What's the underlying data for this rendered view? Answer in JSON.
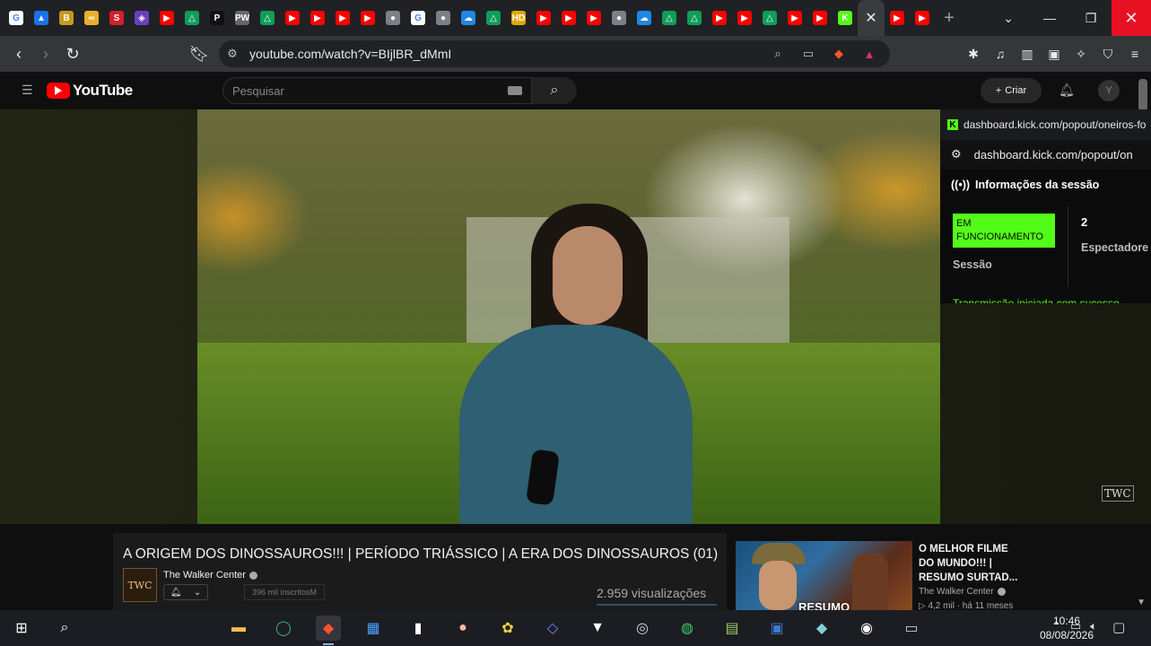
{
  "browser": {
    "tabs": [
      {
        "icon": "google-icon",
        "color": "#ffffff",
        "glyph": "G"
      },
      {
        "icon": "drive-icon",
        "color": "#1a73e8",
        "glyph": "▲"
      },
      {
        "icon": "b-icon",
        "color": "#c49a1c",
        "glyph": "B"
      },
      {
        "icon": "link-icon",
        "color": "#e8b02c",
        "glyph": "∞"
      },
      {
        "icon": "red-s-icon",
        "color": "#d4202a",
        "glyph": "S"
      },
      {
        "icon": "purple-app-icon",
        "color": "#6a3fbf",
        "glyph": "◈"
      },
      {
        "icon": "youtube-icon",
        "color": "#ff0000",
        "glyph": "▶"
      },
      {
        "icon": "google-drive-icon",
        "color": "#0f9d58",
        "glyph": "△"
      },
      {
        "icon": "p-icon",
        "color": "#111111",
        "glyph": "P"
      },
      {
        "icon": "pwm-icon",
        "color": "#666666",
        "glyph": "PW"
      },
      {
        "icon": "google-drive-icon",
        "color": "#0f9d58",
        "glyph": "△"
      },
      {
        "icon": "youtube-icon",
        "color": "#ff0000",
        "glyph": "▶"
      },
      {
        "icon": "youtube-icon",
        "color": "#ff0000",
        "glyph": "▶"
      },
      {
        "icon": "youtube-icon",
        "color": "#ff0000",
        "glyph": "▶"
      },
      {
        "icon": "youtube-icon",
        "color": "#ff0000",
        "glyph": "▶"
      },
      {
        "icon": "github-icon",
        "color": "#7a7f88",
        "glyph": "●"
      },
      {
        "icon": "google-icon",
        "color": "#ffffff",
        "glyph": "G"
      },
      {
        "icon": "github-icon",
        "color": "#7a7f88",
        "glyph": "●"
      },
      {
        "icon": "cloud-icon",
        "color": "#1e88e5",
        "glyph": "☁"
      },
      {
        "icon": "google-drive-icon",
        "color": "#0f9d58",
        "glyph": "△"
      },
      {
        "icon": "hd-icon",
        "color": "#e0a800",
        "glyph": "HD"
      },
      {
        "icon": "youtube-icon",
        "color": "#ff0000",
        "glyph": "▶"
      },
      {
        "icon": "youtube-icon",
        "color": "#ff0000",
        "glyph": "▶"
      },
      {
        "icon": "youtube-icon",
        "color": "#ff0000",
        "glyph": "▶"
      },
      {
        "icon": "github-icon",
        "color": "#7a7f88",
        "glyph": "●"
      },
      {
        "icon": "cloud-icon",
        "color": "#1e88e5",
        "glyph": "☁"
      },
      {
        "icon": "google-drive-icon",
        "color": "#0f9d58",
        "glyph": "△"
      },
      {
        "icon": "google-drive-icon",
        "color": "#0f9d58",
        "glyph": "△"
      },
      {
        "icon": "youtube-icon",
        "color": "#ff0000",
        "glyph": "▶"
      },
      {
        "icon": "youtube-icon",
        "color": "#ff0000",
        "glyph": "▶"
      },
      {
        "icon": "google-drive-icon",
        "color": "#0f9d58",
        "glyph": "△"
      },
      {
        "icon": "youtube-icon",
        "color": "#ff0000",
        "glyph": "▶"
      },
      {
        "icon": "youtube-icon",
        "color": "#ff0000",
        "glyph": "▶"
      },
      {
        "icon": "kick-icon",
        "color": "#53fc18",
        "glyph": "K"
      }
    ],
    "active_tab_close": "✕",
    "tabs_after": [
      {
        "icon": "youtube-icon",
        "color": "#ff0000",
        "glyph": "▶"
      },
      {
        "icon": "youtube-icon",
        "color": "#ff0000",
        "glyph": "▶"
      }
    ],
    "new_tab": "+",
    "url": "youtube.com/watch?v=BIjlBR_dMmI"
  },
  "youtube": {
    "logo_text": "YouTube",
    "search_placeholder": "Pesquisar",
    "create_label": "Criar",
    "video": {
      "title": "A ORIGEM DOS DINOSSAUROS!!! | PERÍODO TRIÁSSICO | A ERA DOS DINOSSAUROS (01)",
      "channel": "The Walker Center",
      "channel_logo_text": "TWC",
      "subscribers": "396 mil inscritosM",
      "views": "2.959 visualizações",
      "watermark": "TWC"
    },
    "recommended": {
      "title": "O MELHOR FILME DO MUNDO!!! | RESUMO SURTAD...",
      "channel": "The Walker Center",
      "meta": "▷ 4,2 mil · há 11 meses",
      "thumb_caption": "RESUMO"
    }
  },
  "kick_popout": {
    "url_small": "dashboard.kick.com/popout/oneiros-fo",
    "url_bar": "dashboard.kick.com/popout/on",
    "section_title": "Informações da sessão",
    "status": "EM FUNCIONAMENTO",
    "status_label": "Sessão",
    "viewers": "2",
    "viewers_label": "Espectadore",
    "message": "Transmissão iniciada com sucesso"
  },
  "taskbar": {
    "time": "10:46",
    "date": "08/08/2026"
  }
}
